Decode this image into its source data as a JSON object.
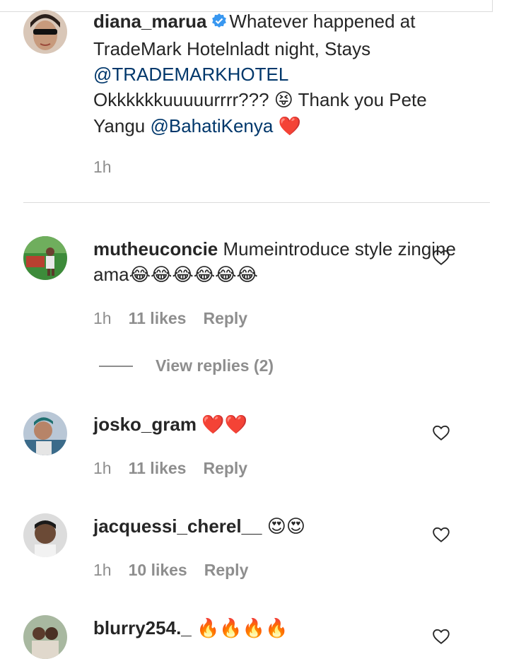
{
  "comments": [
    {
      "username": "diana_marua",
      "verified": true,
      "text_1": "Whatever happened at TradeMark Hotelnladt night, Stays ",
      "mention_1": "@TRADEMARKHOTEL",
      "text_2": " Okkkkkkuuuuurrrr??? ",
      "emoji_1": "😝",
      "text_3": " Thank you Pete Yangu ",
      "mention_2": "@BahatiKenya",
      "emoji_2": "❤️",
      "time": "1h"
    },
    {
      "username": "mutheuconcie",
      "text": "Mumeintroduce style zingine ama",
      "emoji": "😂😂😂😂😂😂",
      "time": "1h",
      "likes": "11 likes",
      "reply": "Reply",
      "view_replies": "View replies (2)"
    },
    {
      "username": "josko_gram",
      "emoji": "❤️❤️",
      "time": "1h",
      "likes": "11 likes",
      "reply": "Reply"
    },
    {
      "username": "jacquessi_cherel__",
      "emoji": "😍😍",
      "time": "1h",
      "likes": "10 likes",
      "reply": "Reply"
    },
    {
      "username": "blurry254._",
      "emoji": "🔥🔥🔥🔥"
    }
  ],
  "colors": {
    "text": "#262626",
    "muted": "#8e8e8e",
    "mention": "#00376b",
    "verified": "#3897f0",
    "divider": "#dbdbdb"
  },
  "icons": [
    "verified-badge-icon",
    "heart-outline-icon"
  ]
}
